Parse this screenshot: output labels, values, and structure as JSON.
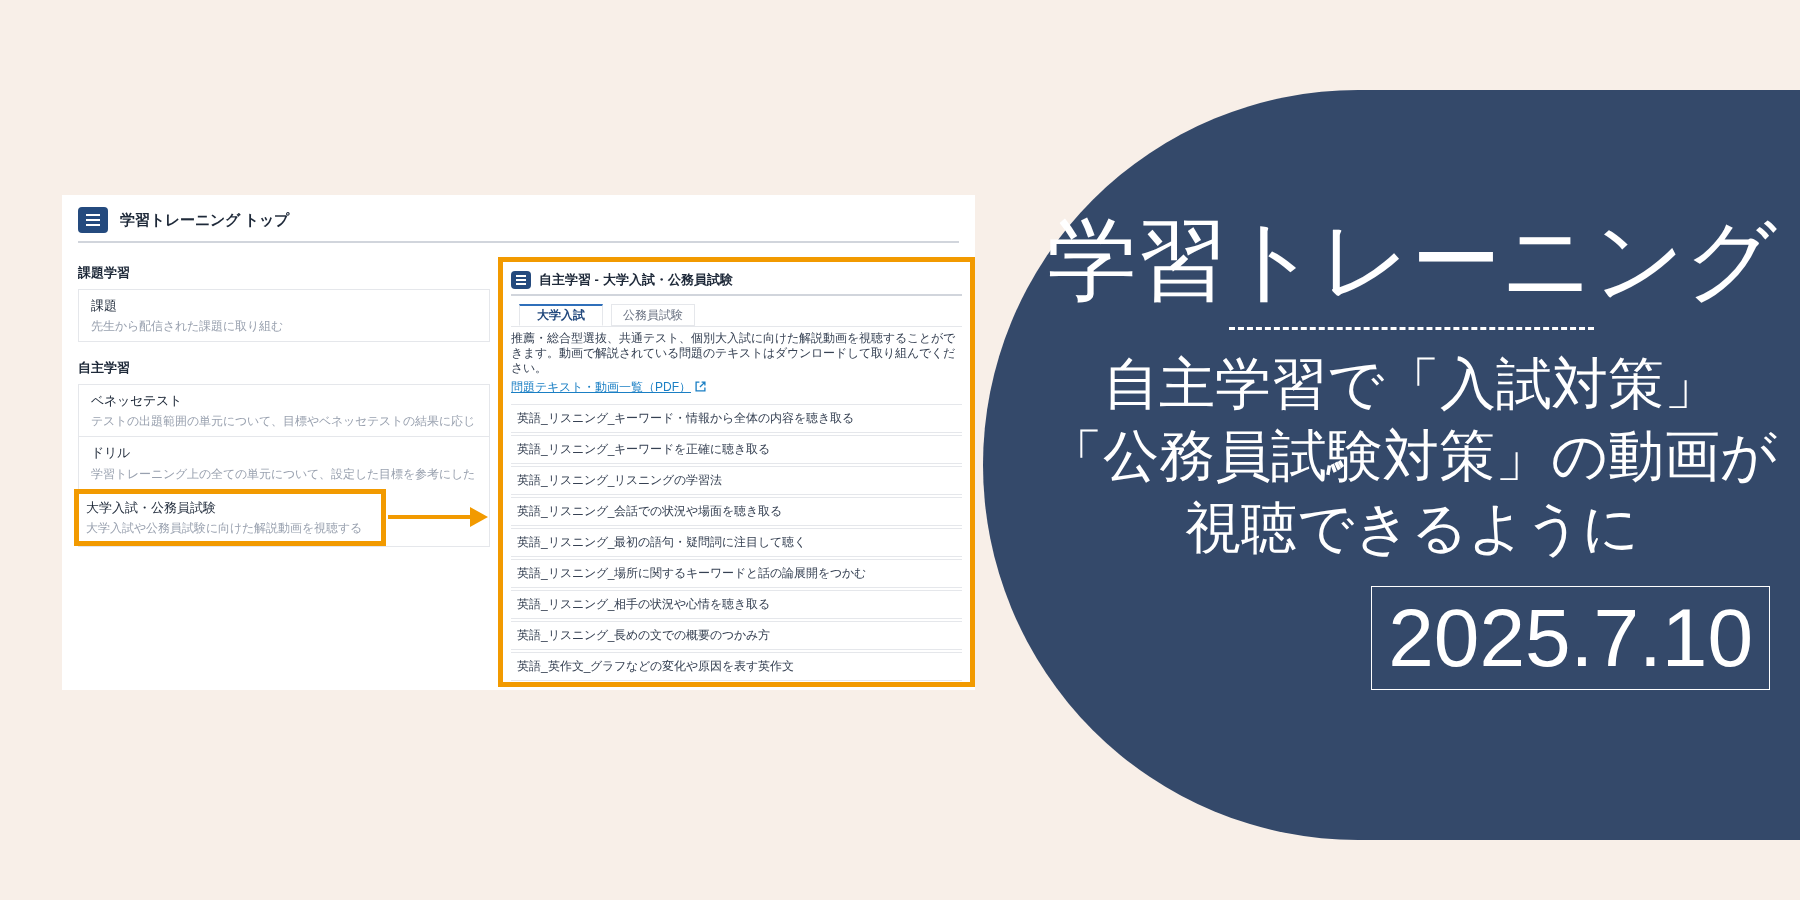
{
  "main_page": {
    "title": "学習トレーニング トップ",
    "sections": [
      {
        "heading": "課題学習",
        "items": [
          {
            "title": "課題",
            "description": "先生から配信された課題に取り組む",
            "highlighted": false
          }
        ]
      },
      {
        "heading": "自主学習",
        "items": [
          {
            "title": "ベネッセテスト",
            "description": "テストの出題範囲の単元について、目標やベネッセテストの結果に応じ",
            "highlighted": false
          },
          {
            "title": "ドリル",
            "description": "学習トレーニング上の全ての単元について、設定した目標を参考にした",
            "highlighted": false
          },
          {
            "title": "大学入試・公務員試験",
            "description": "大学入試や公務員試験に向けた解説動画を視聴する",
            "highlighted": true
          }
        ]
      }
    ]
  },
  "detail_page": {
    "title": "自主学習 - 大学入試・公務員試験",
    "tabs": [
      {
        "label": "大学入試",
        "selected": true
      },
      {
        "label": "公務員試験",
        "selected": false
      }
    ],
    "description": "推薦・総合型選抜、共通テスト、個別大入試に向けた解説動画を視聴することができます。動画で解説されている問題のテキストはダウンロードして取り組んでください。",
    "link": "問題テキスト・動画一覧（PDF）",
    "videos": [
      "英語_リスニング_キーワード・情報から全体の内容を聴き取る",
      "英語_リスニング_キーワードを正確に聴き取る",
      "英語_リスニング_リスニングの学習法",
      "英語_リスニング_会話での状況や場面を聴き取る",
      "英語_リスニング_最初の語句・疑問詞に注目して聴く",
      "英語_リスニング_場所に関するキーワードと話の論展開をつかむ",
      "英語_リスニング_相手の状況や心情を聴き取る",
      "英語_リスニング_長めの文での概要のつかみ方",
      "英語_英作文_グラフなどの変化や原因を表す英作文"
    ]
  },
  "banner": {
    "title": "学習トレーニング",
    "subtitle_lines": [
      "自主学習で「入試対策」",
      "「公務員試験対策」の動画が",
      "視聴できるように"
    ],
    "date": "2025.7.10"
  }
}
